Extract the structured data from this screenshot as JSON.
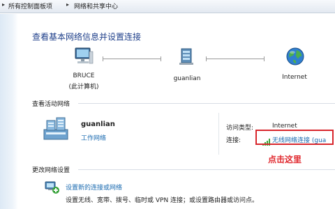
{
  "breadcrumb": {
    "items": [
      "所有控制面板项",
      "网络和共享中心"
    ]
  },
  "page": {
    "title": "查看基本网络信息并设置连接"
  },
  "network_map": {
    "computer": {
      "name": "BRUCE",
      "sub": "(此计算机)"
    },
    "network": {
      "name": "guanlian"
    },
    "internet": {
      "name": "Internet"
    }
  },
  "active_networks": {
    "heading": "查看活动网络",
    "network_name": "guanlian",
    "network_type": "工作网络",
    "access_type_label": "访问类型:",
    "access_type_value": "Internet",
    "connections_label": "连接:",
    "connection_name": "无线网络连接 (gua"
  },
  "annotation": {
    "text": "点击这里",
    "color": "#e0282e"
  },
  "change_settings": {
    "heading": "更改网络设置",
    "task_link": "设置新的连接或网络",
    "task_desc": "设置无线、宽带、拨号、临时或 VPN 连接；或设置路由器或访问点。"
  },
  "icons": {
    "computer": "computer-icon",
    "network": "network-icon",
    "internet": "globe-icon",
    "network_house": "network-house-icon",
    "signal": "signal-bars-icon",
    "new_connection": "new-connection-icon"
  },
  "colors": {
    "link": "#1a6ab0",
    "title": "#1e3f8a",
    "highlight_border": "#d8262c"
  }
}
